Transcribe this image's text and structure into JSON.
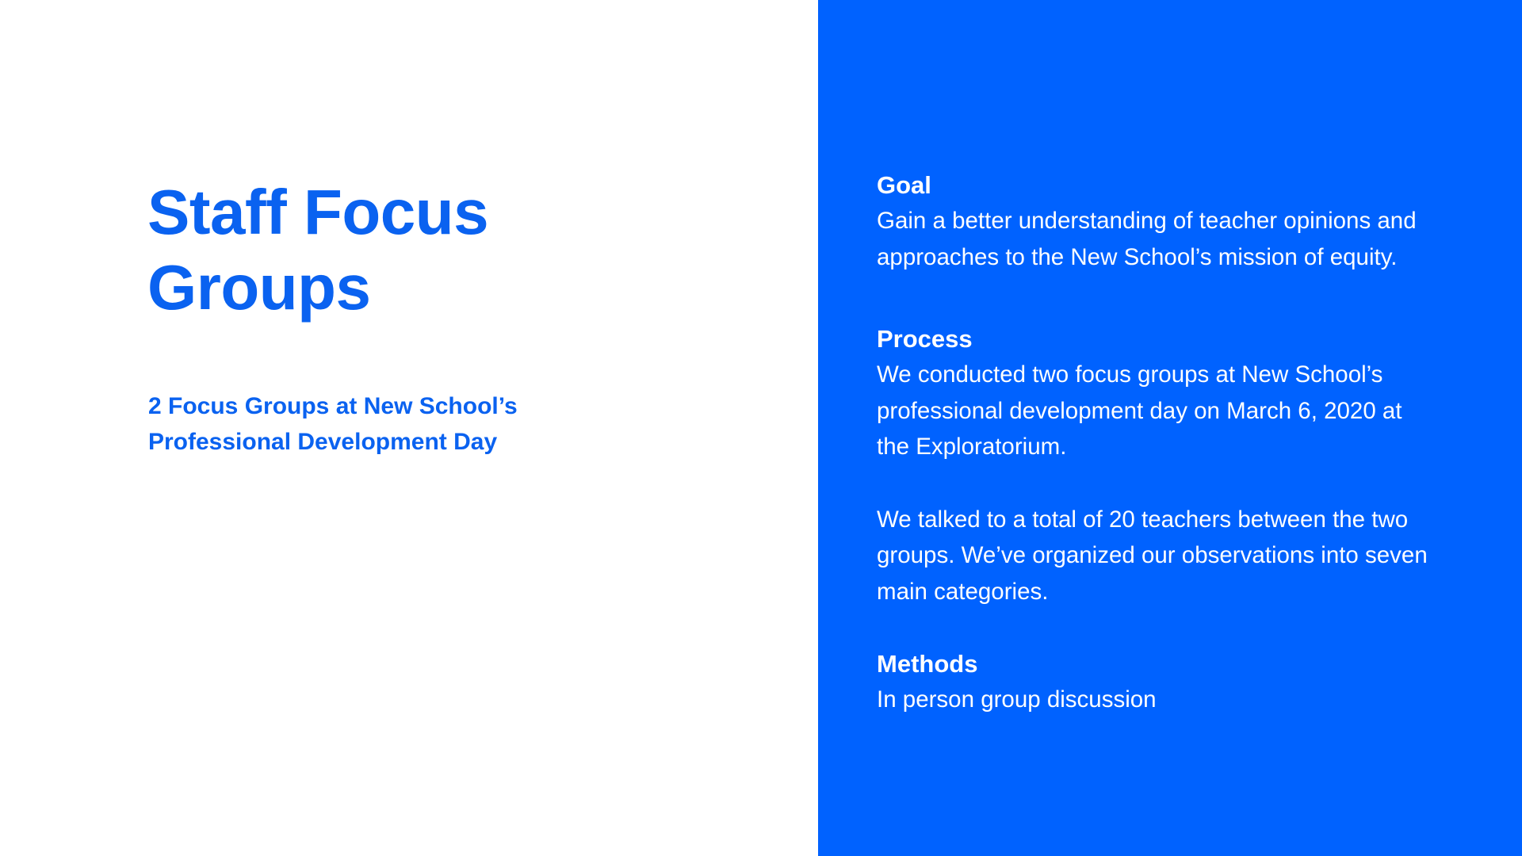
{
  "left": {
    "title": "Staff Focus Groups",
    "subtitle": "2 Focus Groups at New School’s Professional Development Day"
  },
  "right": {
    "goal": {
      "heading": "Goal",
      "text": "Gain a better understanding of teacher opinions and approaches to the New School’s mission of equity."
    },
    "process": {
      "heading": "Process",
      "paragraphs": [
        "We conducted two focus groups at New School’s professional development day on March 6, 2020 at the Exploratorium.",
        "We talked to a total of 20 teachers between the two groups. We’ve organized our observations into seven main categories."
      ]
    },
    "methods": {
      "heading": "Methods",
      "text": "In person group discussion"
    }
  },
  "colors": {
    "accent": "#0A62F0",
    "panel": "#0062FF",
    "background": "#FFFFFF"
  }
}
